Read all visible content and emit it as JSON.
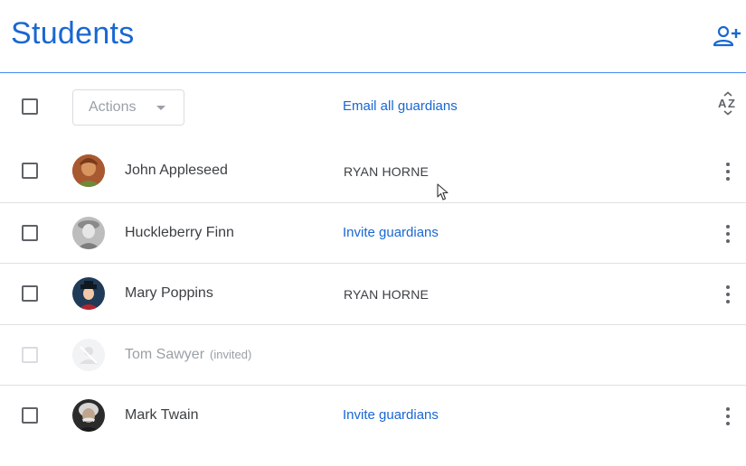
{
  "header": {
    "title": "Students",
    "add_icon": "person-add-icon"
  },
  "toolbar": {
    "actions_label": "Actions",
    "email_all_label": "Email all guardians",
    "sort_icon": "sort-az-icon"
  },
  "students": [
    {
      "name": "John Appleseed",
      "invited": false,
      "guardian": "RYAN HORNE",
      "guardian_is_link": false
    },
    {
      "name": "Huckleberry Finn",
      "invited": false,
      "guardian": "Invite guardians",
      "guardian_is_link": true
    },
    {
      "name": "Mary Poppins",
      "invited": false,
      "guardian": "RYAN HORNE",
      "guardian_is_link": false
    },
    {
      "name": "Tom Sawyer",
      "invited": true,
      "invited_label": "(invited)",
      "guardian": "",
      "guardian_is_link": false
    },
    {
      "name": "Mark Twain",
      "invited": false,
      "guardian": "Invite guardians",
      "guardian_is_link": true
    }
  ],
  "colors": {
    "accent": "#1967d2",
    "divider": "#4285f4",
    "text": "#3c4043",
    "muted": "#9aa0a6"
  }
}
